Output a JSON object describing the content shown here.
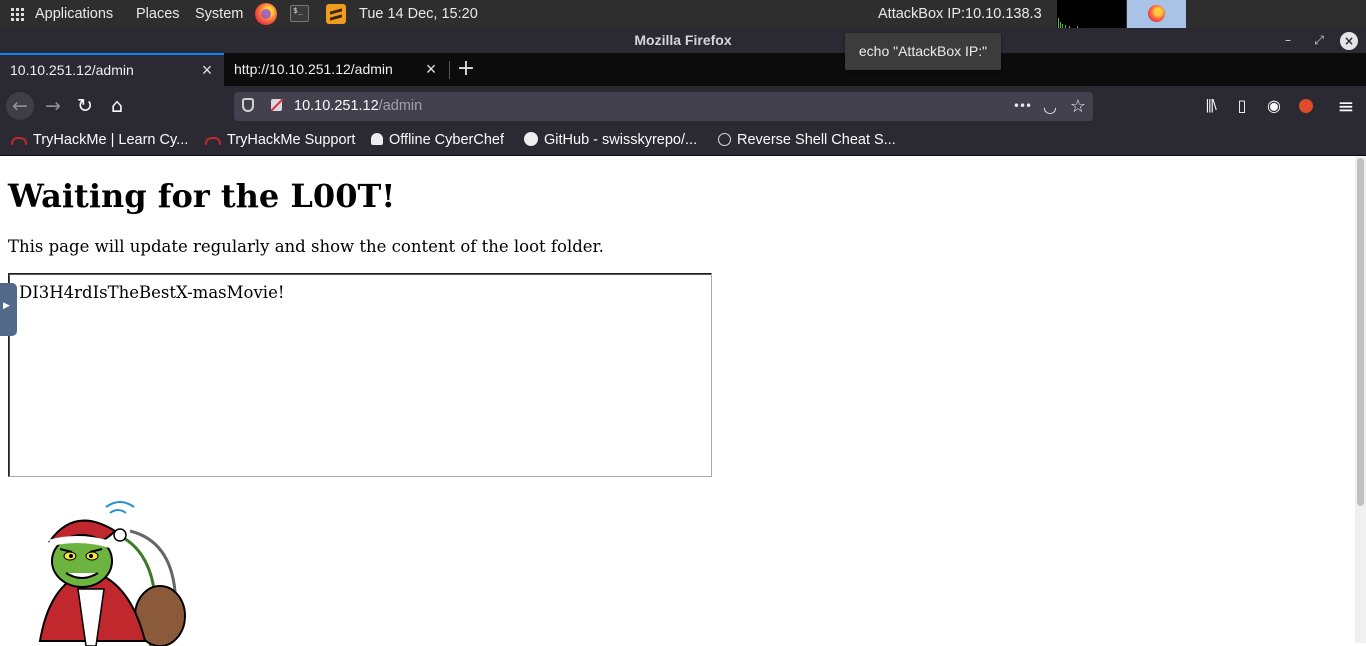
{
  "panel": {
    "menu_applications": "Applications",
    "menu_places": "Places",
    "menu_system": "System",
    "datetime": "Tue 14 Dec, 15:20",
    "attackbox_ip": "AttackBox IP:10.10.138.3"
  },
  "window": {
    "title": "Mozilla Firefox",
    "minimize_glyph": "–",
    "maximize_glyph": "⤢",
    "close_glyph": "×"
  },
  "tabs": [
    {
      "label": "10.10.251.12/admin",
      "active": true
    },
    {
      "label": "http://10.10.251.12/admin",
      "active": false
    }
  ],
  "tab_close_glyph": "×",
  "new_tab_glyph": "+",
  "nav": {
    "back_glyph": "←",
    "forward_glyph": "→",
    "reload_glyph": "↻",
    "home_glyph": "⌂"
  },
  "urlbar": {
    "host": "10.10.251.12",
    "path": "/admin",
    "more_glyph": "•••",
    "pocket_glyph": "◡",
    "star_glyph": "☆"
  },
  "toolbar": {
    "library_glyph": "|||\\",
    "sidebar_glyph": "▯",
    "account_glyph": "◉",
    "menu_glyph": "≡"
  },
  "bookmarks": [
    {
      "label": "TryHackMe | Learn Cy...",
      "icon": "tryhackme-icon"
    },
    {
      "label": "TryHackMe Support",
      "icon": "tryhackme-icon"
    },
    {
      "label": "Offline CyberChef",
      "icon": "chef-hat-icon"
    },
    {
      "label": "GitHub - swisskyrepo/...",
      "icon": "github-icon"
    },
    {
      "label": "Reverse Shell Cheat S...",
      "icon": "globe-icon"
    }
  ],
  "tooltip": "echo \"AttackBox IP:\"",
  "page": {
    "heading": "Waiting for the L00T!",
    "description": "This page will update regularly and show the content of the loot folder.",
    "loot_content": "DI3H4rdIsTheBestX-masMovie!"
  },
  "colors": {
    "panel_bg": "#2e2e2e",
    "browser_chrome": "#2b2a33",
    "tab_accent": "#0a84ff",
    "urlbar_bg": "#42414d"
  }
}
